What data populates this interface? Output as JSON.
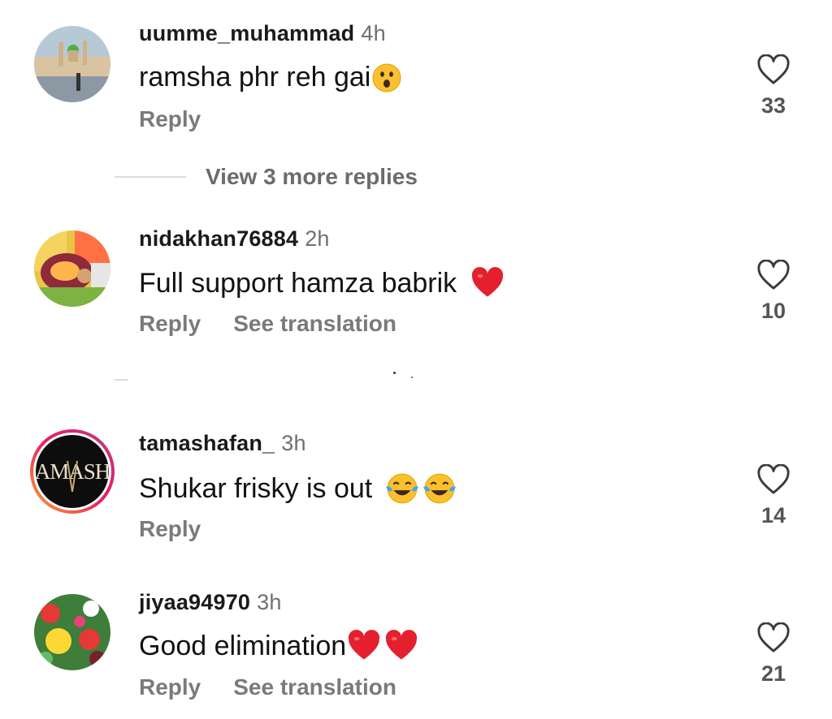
{
  "comments": [
    {
      "username": "uumme_muhammad",
      "time": "4h",
      "text": "ramsha phr reh gai",
      "emojis": [
        "astonished-face"
      ],
      "actions": {
        "reply": "Reply"
      },
      "likes": "33",
      "avatar": "mosque-photo",
      "view_more": "View 3 more replies"
    },
    {
      "username": "nidakhan76884",
      "time": "2h",
      "text": "Full support hamza babrik ",
      "emojis": [
        "red-heart"
      ],
      "actions": {
        "reply": "Reply",
        "translate": "See translation"
      },
      "likes": "10",
      "avatar": "colorful-dress-photo"
    },
    {
      "username": "tamashafan_",
      "time": "3h",
      "text": "Shukar frisky is out ",
      "emojis": [
        "tears-of-joy",
        "tears-of-joy"
      ],
      "actions": {
        "reply": "Reply"
      },
      "likes": "14",
      "avatar": "tamasha-logo",
      "avatar_text": "AMASH"
    },
    {
      "username": "jiyaa94970",
      "time": "3h",
      "text": "Good elimination",
      "emojis": [
        "red-heart",
        "red-heart"
      ],
      "actions": {
        "reply": "Reply",
        "translate": "See translation"
      },
      "likes": "21",
      "avatar": "flowers-photo"
    }
  ],
  "colors": {
    "username": "#1a1a1a",
    "secondary": "#7a7a7a",
    "heart_emoji": "#e5202e",
    "story_ring": [
      "#f9a825",
      "#e91e63",
      "#c13584"
    ]
  }
}
